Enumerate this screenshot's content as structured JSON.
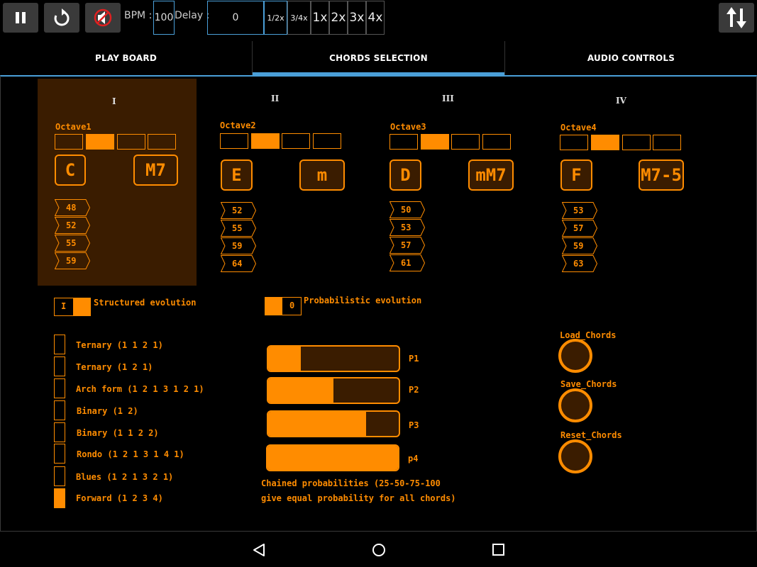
{
  "toolbar": {
    "bpm_label": "BPM :",
    "bpm_value": "100",
    "delay_label": "Delay :",
    "delay_value": "0",
    "speed_options": [
      "1/2x",
      "3/4x",
      "1x",
      "2x",
      "3x",
      "4x"
    ],
    "icons": [
      "pause-icon",
      "restart-icon",
      "mute-icon",
      "swap-vertical-icon"
    ]
  },
  "tabs": [
    "PLAY BOARD",
    "CHORDS SELECTION",
    "AUDIO CONTROLS"
  ],
  "active_tab": "CHORDS SELECTION",
  "chords": [
    {
      "roman": "I",
      "octave": "Octave1",
      "octave_selected": 2,
      "root": "C",
      "quality": "M7",
      "notes": [
        "48",
        "52",
        "55",
        "59"
      ],
      "active": true
    },
    {
      "roman": "II",
      "octave": "Octave2",
      "octave_selected": 2,
      "root": "E",
      "quality": "m",
      "notes": [
        "52",
        "55",
        "59",
        "64"
      ],
      "active": false
    },
    {
      "roman": "III",
      "octave": "Octave3",
      "octave_selected": 2,
      "root": "D",
      "quality": "mM7",
      "notes": [
        "50",
        "53",
        "57",
        "61"
      ],
      "active": false
    },
    {
      "roman": "IV",
      "octave": "Octave4",
      "octave_selected": 2,
      "root": "F",
      "quality": "M7-5",
      "notes": [
        "53",
        "57",
        "59",
        "63"
      ],
      "active": false
    }
  ],
  "structured": {
    "toggle_value": "I",
    "label": "Structured evolution"
  },
  "probabilistic": {
    "toggle_value": "0",
    "label": "Probabilistic evolution"
  },
  "forms": [
    {
      "label": "Ternary (1 1 2 1)",
      "selected": false
    },
    {
      "label": "Ternary (1 2 1)",
      "selected": false
    },
    {
      "label": "Arch form (1 2 1 3 1 2 1)",
      "selected": false
    },
    {
      "label": "Binary (1 2)",
      "selected": false
    },
    {
      "label": "Binary (1 1 2 2)",
      "selected": false
    },
    {
      "label": "Rondo (1 2 1 3 1 4 1)",
      "selected": false
    },
    {
      "label": "Blues (1 2 1 3 2 1)",
      "selected": false
    },
    {
      "label": "Forward (1 2 3 4)",
      "selected": true
    }
  ],
  "probabilities": [
    {
      "label": "P1",
      "value": 0.25
    },
    {
      "label": "P2",
      "value": 0.5
    },
    {
      "label": "P3",
      "value": 0.75
    },
    {
      "label": "p4",
      "value": 1.0
    }
  ],
  "prob_note_line1": "Chained probabilities (25-50-75-100",
  "prob_note_line2": "give equal probability for all chords)",
  "actions": {
    "load": "Load_Chords",
    "save": "Save_Chords",
    "reset": "Reset_Chords"
  },
  "colors": {
    "accent": "#ff8c00",
    "active_bg": "#3a1c00",
    "tab_indicator": "#4a9fd8"
  }
}
